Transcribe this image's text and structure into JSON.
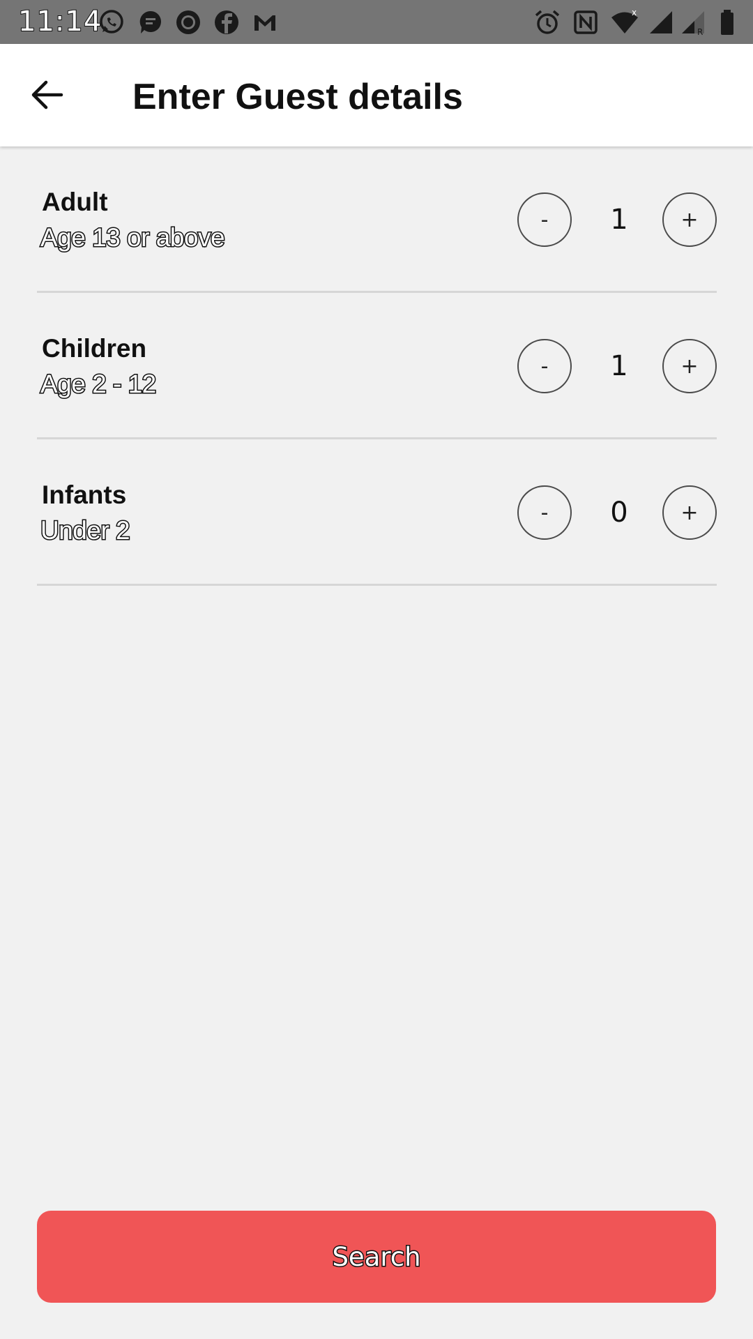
{
  "status_bar": {
    "time": "11:14",
    "left_icons": [
      "whatsapp-icon",
      "messages-icon",
      "circle-app-icon",
      "facebook-icon",
      "gmail-icon"
    ],
    "right_icons": [
      "alarm-icon",
      "nfc-icon",
      "wifi-icon",
      "signal-icon",
      "signal-roaming-icon",
      "battery-icon"
    ]
  },
  "header": {
    "title": "Enter Guest details",
    "back_icon": "arrow-left-icon"
  },
  "guests": [
    {
      "label": "Adult",
      "description": "Age 13 or above",
      "count": "1",
      "minus": "-",
      "plus": "+"
    },
    {
      "label": "Children",
      "description": "Age 2 - 12",
      "count": "1",
      "minus": "-",
      "plus": "+"
    },
    {
      "label": "Infants",
      "description": "Under 2",
      "count": "0",
      "minus": "-",
      "plus": "+"
    }
  ],
  "search_button": {
    "label": "Search",
    "color": "#f05556"
  }
}
